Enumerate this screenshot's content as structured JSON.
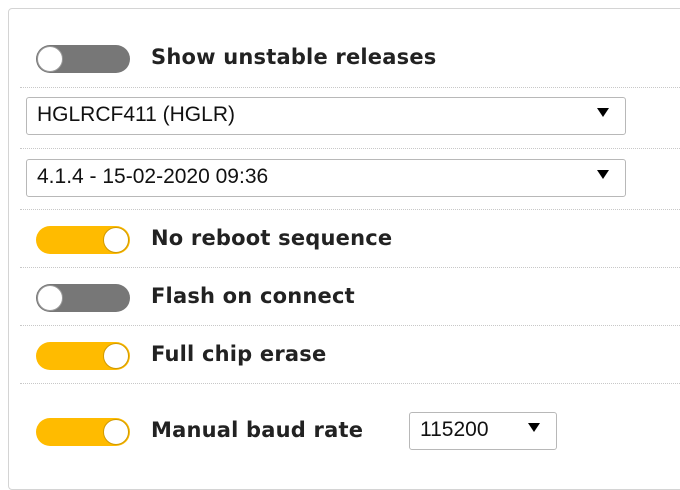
{
  "options": {
    "show_unstable": {
      "label": "Show unstable releases",
      "on": false
    },
    "no_reboot": {
      "label": "No reboot sequence",
      "on": true
    },
    "flash_on_connect": {
      "label": "Flash on connect",
      "on": false
    },
    "full_chip_erase": {
      "label": "Full chip erase",
      "on": true
    },
    "manual_baud": {
      "label": "Manual baud rate",
      "on": true
    }
  },
  "board_select": {
    "value": "HGLRCF411 (HGLR)"
  },
  "firmware_select": {
    "value": "4.1.4 - 15-02-2020 09:36"
  },
  "baud_select": {
    "value": "115200"
  },
  "colors": {
    "toggle_on": "#ffbb00",
    "toggle_off": "#777777"
  }
}
